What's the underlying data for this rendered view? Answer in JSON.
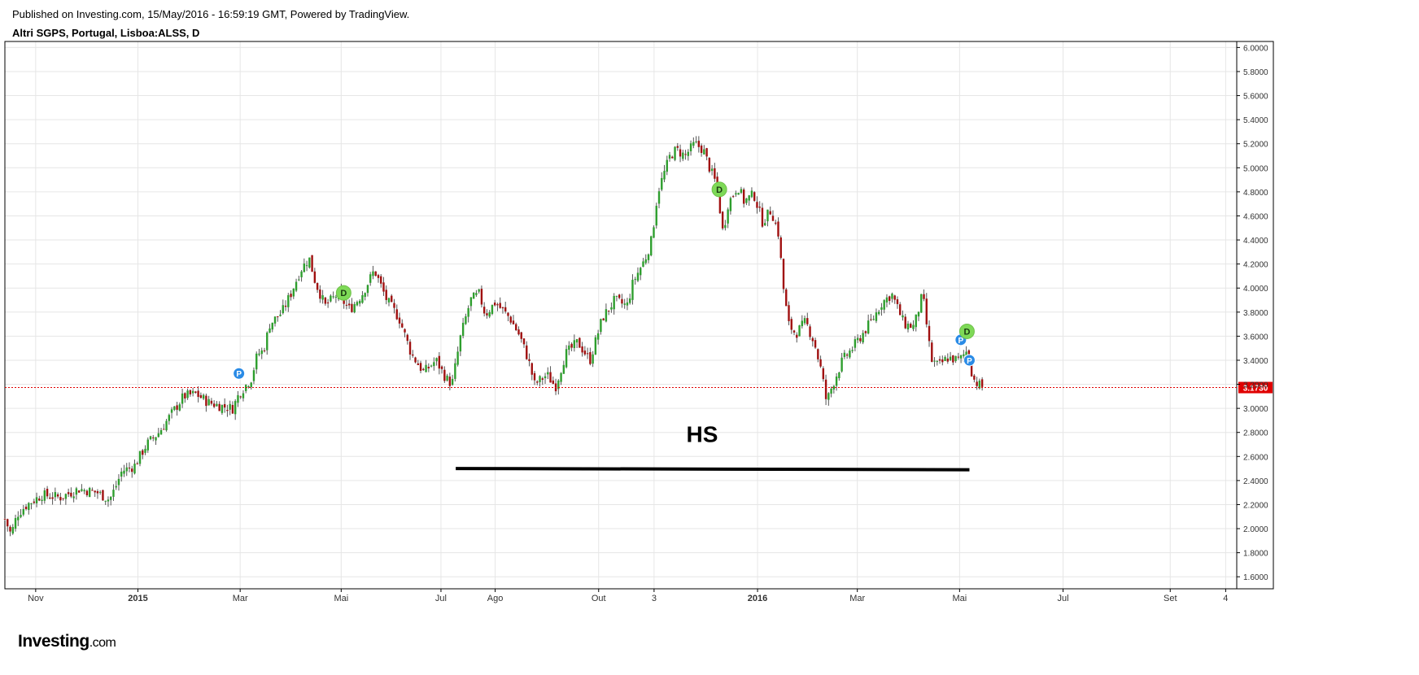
{
  "header": {
    "published": "Published on Investing.com, 15/May/2016 - 16:59:19 GMT, Powered by TradingView.",
    "symbol": "Altri SGPS, Portugal, Lisboa:ALSS, D"
  },
  "logo": {
    "brand": "Investing",
    "domain": ".com"
  },
  "chart_data": {
    "type": "candlestick",
    "title": "Altri SGPS, Portugal, Lisboa:ALSS, D",
    "ylim": [
      1.5,
      6.05
    ],
    "grid": true,
    "x_ticks": [
      {
        "label": "Nov",
        "t": 0.025,
        "bold": false
      },
      {
        "label": "2015",
        "t": 0.108,
        "bold": true
      },
      {
        "label": "Mar",
        "t": 0.191,
        "bold": false
      },
      {
        "label": "Mai",
        "t": 0.273,
        "bold": false
      },
      {
        "label": "Jul",
        "t": 0.354,
        "bold": false
      },
      {
        "label": "Ago",
        "t": 0.398,
        "bold": false
      },
      {
        "label": "Out",
        "t": 0.482,
        "bold": false
      },
      {
        "label": "3",
        "t": 0.527,
        "bold": false
      },
      {
        "label": "2016",
        "t": 0.611,
        "bold": true
      },
      {
        "label": "Mar",
        "t": 0.692,
        "bold": false
      },
      {
        "label": "Mai",
        "t": 0.775,
        "bold": false
      },
      {
        "label": "Jul",
        "t": 0.859,
        "bold": false
      },
      {
        "label": "Set",
        "t": 0.946,
        "bold": false
      },
      {
        "label": "4",
        "t": 0.991,
        "bold": false
      }
    ],
    "y_ticks": [
      "6.0000",
      "5.8000",
      "5.6000",
      "5.4000",
      "5.2000",
      "5.0000",
      "4.8000",
      "4.6000",
      "4.4000",
      "4.2000",
      "4.0000",
      "3.8000",
      "3.6000",
      "3.4000",
      "3.2000",
      "3.0000",
      "2.8000",
      "2.6000",
      "2.4000",
      "2.2000",
      "2.0000",
      "1.8000",
      "1.6000"
    ],
    "last_price": 3.173,
    "last_price_label": "3.1730",
    "colors": {
      "up": "#2e9e2e",
      "down": "#a01010",
      "price_line": "#e00000",
      "grid": "#e6e6e6",
      "event_P": "#2a8be6",
      "event_D": "#7ed957"
    },
    "price_path": [
      [
        0.0,
        2.08
      ],
      [
        0.005,
        1.95
      ],
      [
        0.01,
        2.12
      ],
      [
        0.018,
        2.2
      ],
      [
        0.03,
        2.28
      ],
      [
        0.045,
        2.26
      ],
      [
        0.06,
        2.33
      ],
      [
        0.075,
        2.3
      ],
      [
        0.085,
        2.24
      ],
      [
        0.09,
        2.35
      ],
      [
        0.095,
        2.48
      ],
      [
        0.105,
        2.52
      ],
      [
        0.115,
        2.7
      ],
      [
        0.125,
        2.8
      ],
      [
        0.135,
        2.95
      ],
      [
        0.145,
        3.1
      ],
      [
        0.155,
        3.12
      ],
      [
        0.165,
        3.05
      ],
      [
        0.175,
        3.02
      ],
      [
        0.185,
        3.0
      ],
      [
        0.19,
        3.12
      ],
      [
        0.2,
        3.25
      ],
      [
        0.205,
        3.45
      ],
      [
        0.21,
        3.48
      ],
      [
        0.215,
        3.7
      ],
      [
        0.225,
        3.8
      ],
      [
        0.232,
        3.95
      ],
      [
        0.24,
        4.15
      ],
      [
        0.247,
        4.25
      ],
      [
        0.252,
        4.05
      ],
      [
        0.26,
        3.85
      ],
      [
        0.27,
        3.95
      ],
      [
        0.28,
        3.82
      ],
      [
        0.29,
        3.95
      ],
      [
        0.3,
        4.15
      ],
      [
        0.31,
        3.9
      ],
      [
        0.32,
        3.75
      ],
      [
        0.33,
        3.45
      ],
      [
        0.34,
        3.3
      ],
      [
        0.35,
        3.4
      ],
      [
        0.358,
        3.25
      ],
      [
        0.363,
        3.2
      ],
      [
        0.37,
        3.6
      ],
      [
        0.378,
        3.9
      ],
      [
        0.385,
        3.95
      ],
      [
        0.39,
        3.78
      ],
      [
        0.398,
        3.88
      ],
      [
        0.41,
        3.75
      ],
      [
        0.418,
        3.6
      ],
      [
        0.425,
        3.4
      ],
      [
        0.43,
        3.2
      ],
      [
        0.44,
        3.28
      ],
      [
        0.447,
        3.18
      ],
      [
        0.455,
        3.45
      ],
      [
        0.465,
        3.55
      ],
      [
        0.475,
        3.4
      ],
      [
        0.485,
        3.75
      ],
      [
        0.495,
        3.9
      ],
      [
        0.505,
        3.85
      ],
      [
        0.51,
        4.05
      ],
      [
        0.52,
        4.25
      ],
      [
        0.525,
        4.4
      ],
      [
        0.53,
        4.8
      ],
      [
        0.535,
        4.95
      ],
      [
        0.54,
        5.1
      ],
      [
        0.545,
        5.15
      ],
      [
        0.552,
        5.1
      ],
      [
        0.56,
        5.2
      ],
      [
        0.567,
        5.15
      ],
      [
        0.572,
        5.0
      ],
      [
        0.578,
        4.85
      ],
      [
        0.583,
        4.45
      ],
      [
        0.587,
        4.7
      ],
      [
        0.595,
        4.85
      ],
      [
        0.6,
        4.72
      ],
      [
        0.608,
        4.78
      ],
      [
        0.615,
        4.55
      ],
      [
        0.622,
        4.65
      ],
      [
        0.628,
        4.45
      ],
      [
        0.632,
        4.0
      ],
      [
        0.636,
        3.7
      ],
      [
        0.642,
        3.62
      ],
      [
        0.65,
        3.72
      ],
      [
        0.657,
        3.55
      ],
      [
        0.663,
        3.3
      ],
      [
        0.667,
        3.05
      ],
      [
        0.672,
        3.2
      ],
      [
        0.68,
        3.4
      ],
      [
        0.688,
        3.5
      ],
      [
        0.695,
        3.6
      ],
      [
        0.705,
        3.75
      ],
      [
        0.712,
        3.88
      ],
      [
        0.72,
        3.95
      ],
      [
        0.73,
        3.7
      ],
      [
        0.738,
        3.68
      ],
      [
        0.745,
        3.95
      ],
      [
        0.752,
        3.4
      ],
      [
        0.758,
        3.35
      ],
      [
        0.765,
        3.42
      ],
      [
        0.775,
        3.4
      ],
      [
        0.781,
        3.48
      ],
      [
        0.786,
        3.25
      ],
      [
        0.79,
        3.2
      ],
      [
        0.795,
        3.17
      ]
    ],
    "events": [
      {
        "label": "P",
        "t": 0.19,
        "price": 3.29,
        "r": 7
      },
      {
        "label": "D",
        "t": 0.275,
        "price": 3.96,
        "r": 9
      },
      {
        "label": "D",
        "t": 0.58,
        "price": 4.82,
        "r": 9
      },
      {
        "label": "P",
        "t": 0.776,
        "price": 3.57,
        "r": 7
      },
      {
        "label": "D",
        "t": 0.781,
        "price": 3.64,
        "r": 9
      },
      {
        "label": "P",
        "t": 0.783,
        "price": 3.4,
        "r": 7
      }
    ],
    "annotations": [
      {
        "text": "HS",
        "t": 0.566,
        "price": 2.72
      },
      {
        "type": "trendline",
        "t1": 0.366,
        "t2": 0.783,
        "price1": 2.5,
        "price2": 2.49
      }
    ]
  }
}
